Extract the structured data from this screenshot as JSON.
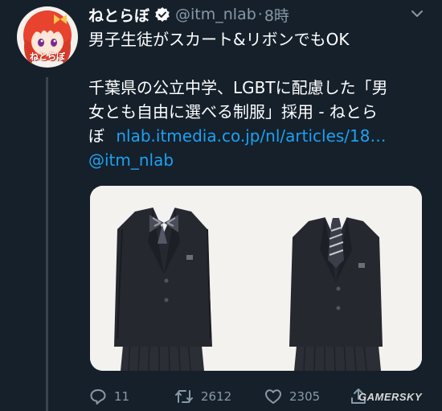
{
  "tweet": {
    "display_name": "ねとらぼ",
    "handle": "@itm_nlab",
    "separator": "·",
    "time": "8時",
    "lines": [
      "男子生徒がスカート&リボンでもOK",
      "千葉県の公立中学、LGBTに配慮した「男",
      "女とも自由に選べる制服」採用 - ねとら",
      "ぼ"
    ],
    "link_url": "nlab.itmedia.co.jp/nl/articles/18…",
    "mention": "@itm_nlab"
  },
  "avatar": {
    "text": "ねとらぼ"
  },
  "actions": {
    "reply_count": "11",
    "retweet_count": "2612",
    "like_count": "2305"
  },
  "icons": {
    "verified": "verified-badge-icon",
    "menu": "chevron-down-icon",
    "reply": "reply-icon",
    "retweet": "retweet-icon",
    "like": "heart-icon",
    "share": "share-icon"
  },
  "colors": {
    "background": "#15202b",
    "secondary_text": "#8899a6",
    "link": "#1da1f2"
  },
  "watermark": "GAMERSKY"
}
